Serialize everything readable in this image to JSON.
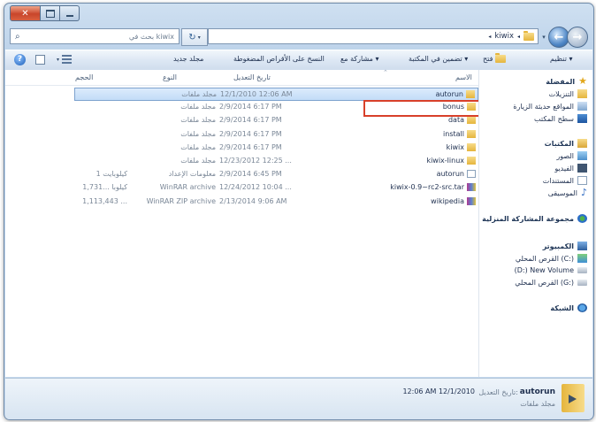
{
  "window": {
    "close_glyph": "✕",
    "search_placeholder": "بحث في kiwix",
    "breadcrumb": [
      "kiwix"
    ],
    "refresh_glyph": "↻"
  },
  "toolbar": {
    "organize": "تنظيم ▾",
    "open": "فتح",
    "include_in_library": "تضمين في المكتبة ▾",
    "share_with": "مشاركة مع ▾",
    "burn": "النسخ على الأقراص المضغوطة",
    "new_folder": "مجلد جديد",
    "help_glyph": "?"
  },
  "columns": {
    "name": "الاسم",
    "date_modified": "تاريخ التعديل",
    "type": "النوع",
    "size": "الحجم"
  },
  "files": [
    {
      "name": "autorun",
      "date": "12/1/2010 12:06 AM",
      "type": "مجلد ملفات",
      "size": "",
      "icon": "folder-icon"
    },
    {
      "name": "bonus",
      "date": "2/9/2014 6:17 PM",
      "type": "مجلد ملفات",
      "size": "",
      "icon": "folder-icon"
    },
    {
      "name": "data",
      "date": "2/9/2014 6:17 PM",
      "type": "مجلد ملفات",
      "size": "",
      "icon": "folder-icon"
    },
    {
      "name": "install",
      "date": "2/9/2014 6:17 PM",
      "type": "مجلد ملفات",
      "size": "",
      "icon": "folder-icon"
    },
    {
      "name": "kiwix",
      "date": "2/9/2014 6:17 PM",
      "type": "مجلد ملفات",
      "size": "",
      "icon": "folder-icon"
    },
    {
      "name": "kiwix-linux",
      "date": "12/23/2012 12:25 ...",
      "type": "مجلد ملفات",
      "size": "",
      "icon": "folder-icon"
    },
    {
      "name": "autorun",
      "date": "2/9/2014 6:45 PM",
      "type": "معلومات الإعداد",
      "size": "1 كيلوبايت",
      "icon": "setup-info-icon"
    },
    {
      "name": "kiwix-0.9~rc2-src.tar",
      "date": "12/24/2012 10:04 ...",
      "type": "WinRAR archive",
      "size": "1,731... كيلوبا",
      "icon": "winrar-archive-icon"
    },
    {
      "name": "wikipedia",
      "date": "2/13/2014 9:06 AM",
      "type": "WinRAR ZIP archive",
      "size": "1,113,443 ...",
      "icon": "winrar-zip-icon"
    }
  ],
  "nav": {
    "favorites": "المفضلة",
    "downloads": "التنزيلات",
    "recent_places": "المواقع حديثة الزيارة",
    "desktop": "سطح المكتب",
    "libraries": "المكتبات",
    "pictures": "الصور",
    "videos": "الفيديو",
    "documents": "المستندات",
    "music": "الموسيقى",
    "homegroup": "مجموعة المشاركة المنزلية",
    "computer": "الكمبيوتر",
    "drive_c": "القرص المحلي (C:)",
    "drive_d": "(D:) New Volume",
    "drive_g": "القرص المحلي (G:)",
    "network": "الشبكة"
  },
  "details": {
    "name": "autorun",
    "modified_label": "تاريخ التعديل:",
    "modified_value": "12:06 AM 12/1/2010",
    "type": "مجلد ملفات"
  },
  "colors": {
    "selection": "#cce4fb",
    "highlight_box": "#d8402a"
  }
}
